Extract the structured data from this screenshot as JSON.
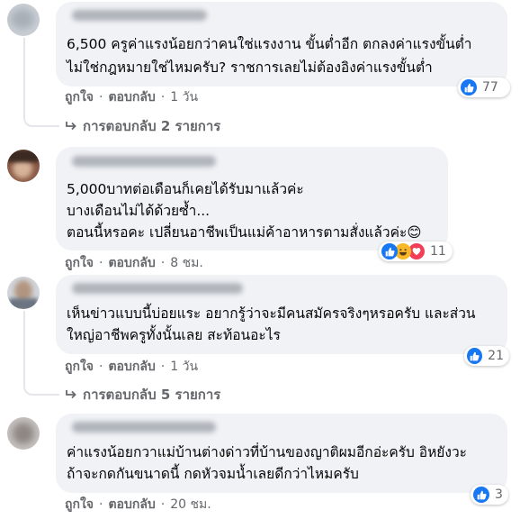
{
  "icons": {
    "like": "thumbs-up-icon",
    "love": "heart-icon",
    "haha": "laughing-face-icon",
    "reply_arrow": "reply-arrow-icon"
  },
  "colors": {
    "like_blue": "#1877f2",
    "love_red": "#f33e58",
    "haha_yellow": "#f7b928",
    "bubble": "#f0f2f5",
    "meta_gray": "#65676b"
  },
  "comments": [
    {
      "lines": [
        "6,500 ครูค่าแรงน้อยกว่าคนใช่แรงงาน ขั้นต่ำอีก ตกลงค่าแรงขั้นต่ำ",
        "ไม่ใช่กฎหมายใช่ไหมครับ? ราชการเลยไม่ต้องอิงค่าแรงขั้นต่ำ"
      ],
      "like": "ถูกใจ",
      "reply": "ตอบกลับ",
      "time": "1 วัน",
      "reaction_count": "77",
      "replies_label": "การตอบกลับ 2 รายการ"
    },
    {
      "lines": [
        "5,000บาทต่อเดือนก็เคยได้รับมาแล้วค่ะ",
        "บางเดือนไม่ได้ด้วยซ้ำ...",
        "ตอนนี้หรอคะ เปลี่ยนอาชีพเป็นแม่ค้าอาหารตามสั่งแล้วค่ะ😊"
      ],
      "like": "ถูกใจ",
      "reply": "ตอบกลับ",
      "time": "8 ชม.",
      "reaction_count": "11"
    },
    {
      "lines": [
        "เห็นข่าวแบบนี้บ่อยแระ อยากรู้ว่าจะมีคนสมัครจริงๆหรอครับ และส่วน",
        "ใหญ่อาชีพครูทั้งนั้นเลย สะท้อนอะไร"
      ],
      "like": "ถูกใจ",
      "reply": "ตอบกลับ",
      "time": "1 วัน",
      "reaction_count": "21",
      "replies_label": "การตอบกลับ 5 รายการ"
    },
    {
      "lines": [
        "ค่าแรงน้อยกวาแม่บ้านต่างด่าวที่บ้านของญาติผมอีกอ่ะครับ อิหยังวะ",
        "ถ้าจะกดกันขนาดนี้ กดหัวจมน้ำเลยดีกว่าไหมครับ"
      ],
      "like": "ถูกใจ",
      "reply": "ตอบกลับ",
      "time": "20 ชม.",
      "reaction_count": "3"
    }
  ]
}
